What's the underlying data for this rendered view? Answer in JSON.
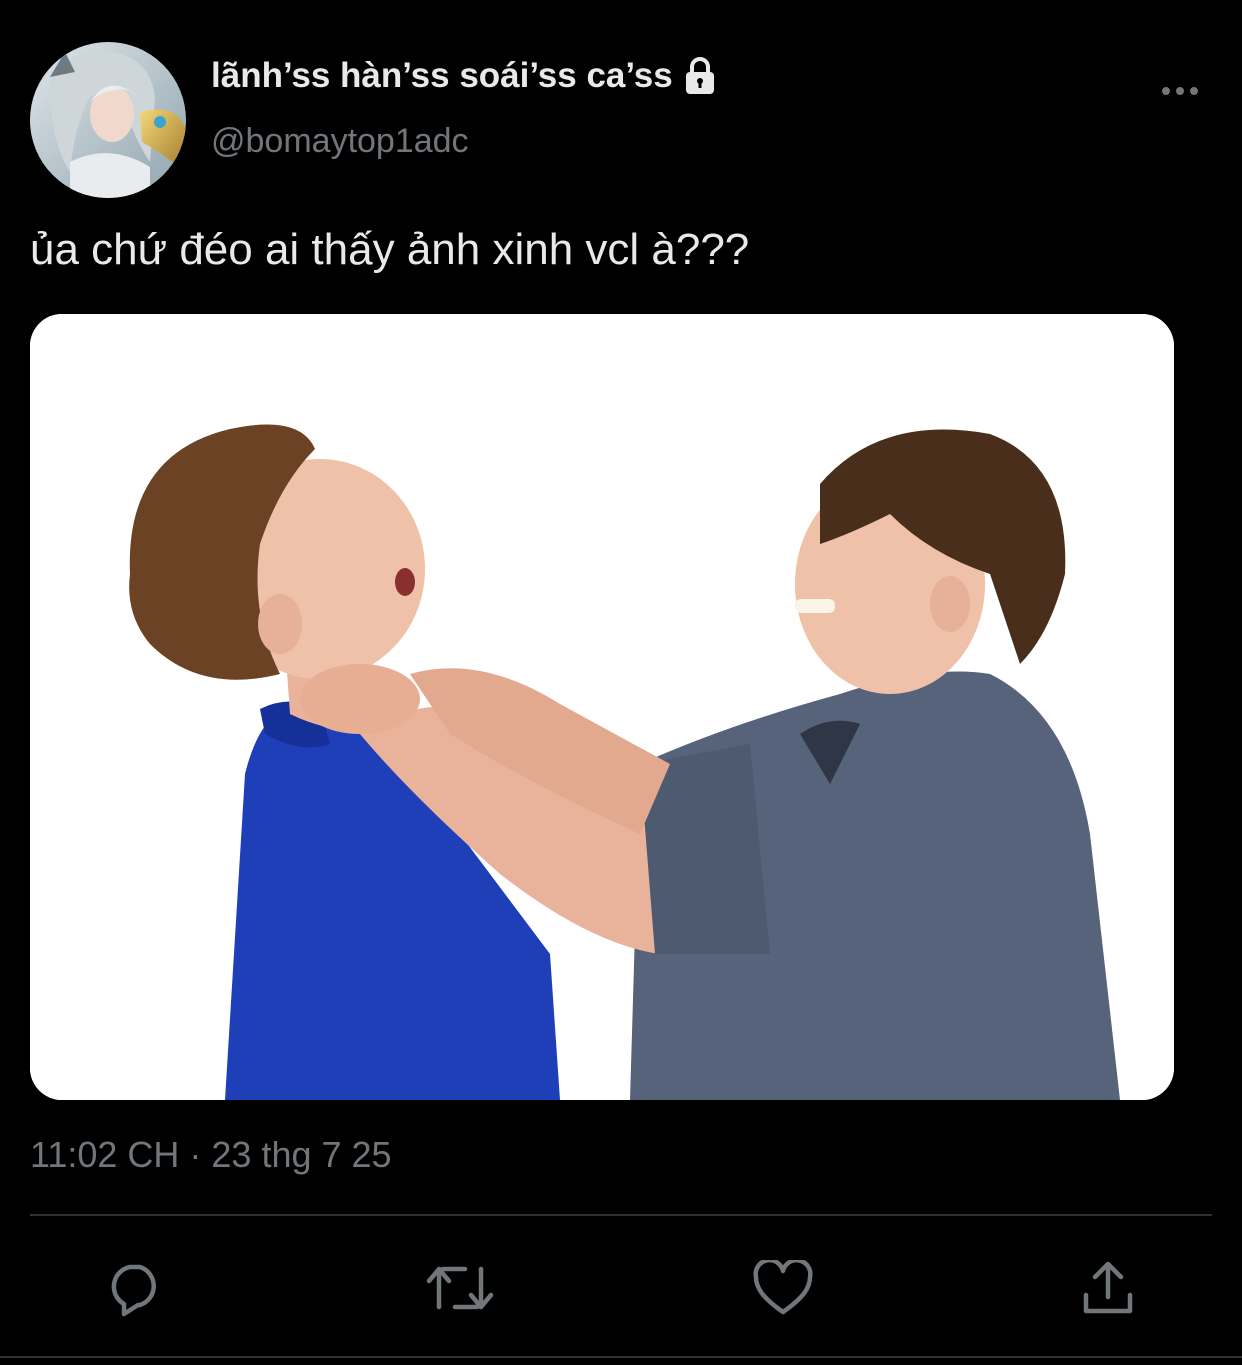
{
  "author": {
    "display_name": "lãnh’ss hàn’ss soái’ss ca’ss",
    "handle": "@bomaytop1adc",
    "protected_icon": "lock-icon",
    "avatar_icon": "avatar-image"
  },
  "tweet": {
    "text": "ủa chứ đéo ai thấy ảnh xinh vcl à???",
    "timestamp": "11:02 CH · 23 thg 7 25",
    "media_description_icon": "photo-image"
  },
  "actions": {
    "reply_icon": "reply-icon",
    "retweet_icon": "retweet-icon",
    "like_icon": "heart-icon",
    "share_icon": "share-icon",
    "more_icon": "more-icon"
  },
  "colors": {
    "background": "#000000",
    "primary_text": "#e7e9ea",
    "secondary_text": "#71767b",
    "divider": "#2f3336"
  }
}
